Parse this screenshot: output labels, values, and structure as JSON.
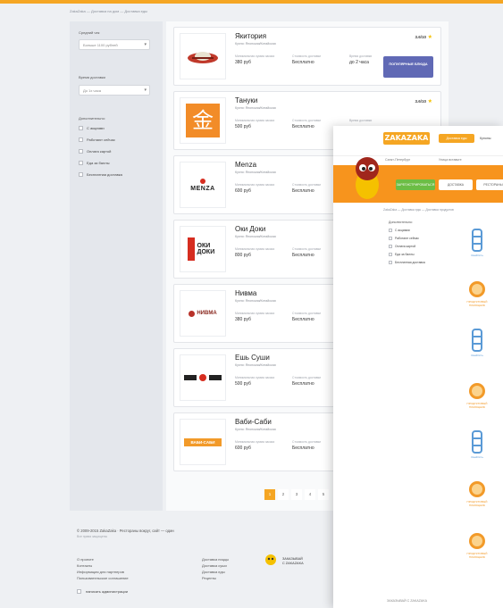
{
  "breadcrumb": "ZakaZaka — Доставка на дом — Доставка еды",
  "sidebar": {
    "avg_check_label": "Средний чек",
    "avg_check_value": "Больше 1100 рублей",
    "delivery_time_label": "Время доставки",
    "delivery_time_value": "До 1х часа",
    "extra_label": "Дополнительно:",
    "options": [
      "С акциями",
      "Работают сейчас",
      "Оплата картой",
      "Еда за баллы",
      "Бесплатная доставка"
    ]
  },
  "labels": {
    "min_order": "Минимальная сумма заказа",
    "delivery_cost": "Стоимость доставки",
    "delivery_time": "Время доставки",
    "menu_button": "ПОПУЛЯРНЫЕ БЛЮДА",
    "cuisine": "Кухня: Японская/Китайская"
  },
  "restaurants": [
    {
      "name": "Якитория",
      "min": "380 руб",
      "cost": "Бесплатно",
      "time": "до 2 часа",
      "rating": "3.6/10",
      "logo": "yakitoriya-logo",
      "logo_text": ""
    },
    {
      "name": "Тануки",
      "min": "500 руб",
      "cost": "Бесплатно",
      "time": "",
      "rating": "3.6/10",
      "logo": "tanuki-logo",
      "logo_text": "金"
    },
    {
      "name": "Menza",
      "min": "600 руб",
      "cost": "Бесплатно",
      "time": "",
      "rating": "",
      "logo": "menza-logo",
      "logo_text": "MENZA"
    },
    {
      "name": "Оки Доки",
      "min": "800 руб",
      "cost": "Бесплатно",
      "time": "",
      "rating": "",
      "logo": "oki-doki-logo",
      "logo_text": "ОКИ ДОКИ"
    },
    {
      "name": "Нивма",
      "min": "380 руб",
      "cost": "Бесплатно",
      "time": "",
      "rating": "",
      "logo": "nivma-logo",
      "logo_text": "НИВМА"
    },
    {
      "name": "Ешь Суши",
      "min": "500 руб",
      "cost": "Бесплатно",
      "time": "",
      "rating": "",
      "logo": "esh-sushi-logo",
      "logo_text": ""
    },
    {
      "name": "Ваби-Саби",
      "min": "600 руб",
      "cost": "Бесплатно",
      "time": "",
      "rating": "",
      "logo": "vabi-sabi-logo",
      "logo_text": "ВАБИ-САБИ"
    }
  ],
  "pagination": [
    "1",
    "2",
    "3",
    "4",
    "5"
  ],
  "footer": {
    "copyright": "© 2009-2015 ZakaZaka · Рестораны вокруг, сайт — один",
    "subline": "Все права защищены",
    "links_col1": [
      "О проекте",
      "Контакты",
      "Информация для партнеров",
      "Пользовательское соглашение"
    ],
    "links_col2": [
      "Доставка пиццы",
      "Доставка суши",
      "Доставка еды",
      "Рецепты"
    ],
    "app_line1": "ЗАКАЗЫВАЙ",
    "app_line2": "С ZAKAZAKA",
    "admin_label": "написать администрации"
  },
  "overlay": {
    "logo_text": "ZAKAZAKA",
    "tab_active": "Доставка еды",
    "tab_other": "Купоны",
    "city": "Санкт-Петербург",
    "street": "Улица вставьте",
    "btn_green": "ЗАРЕГИСТРИРОВАТЬСЯ",
    "btn_gray1": "ДОСТАВКА",
    "btn_gray2": "РЕСТОРАНЫ",
    "breadcrumb": "ZakaZaka — Доставка еды — Доставка продуктов",
    "filter_title": "Дополнительно:",
    "filters": [
      "С акциями",
      "Работают сейчас",
      "Оплата картой",
      "Еда за баллы",
      "Бесплатная доставка"
    ],
    "restaurants": [
      {
        "caption": "ОкейОсть",
        "color": "#5a9ad6"
      },
      {
        "caption": "ПРОДУКТОВЫЙ ПОМОЩНИК",
        "color": "#f29a29"
      },
      {
        "caption": "ОкейОсть",
        "color": "#5a9ad6"
      },
      {
        "caption": "ПРОДУКТОВЫЙ ПОМОЩНИК",
        "color": "#f29a29"
      },
      {
        "caption": "ОкейОсть",
        "color": "#5a9ad6"
      },
      {
        "caption": "ПРОДУКТОВЫЙ ПОМОЩНИК",
        "color": "#f29a29"
      },
      {
        "caption": "ПРОДУКТОВЫЙ ПОМОЩНИК",
        "color": "#f29a29"
      }
    ],
    "footer_text": "ЗАКАЗЫВАЙ С ZAKAZAKA"
  },
  "colors": {
    "accent": "#f5a623",
    "button_purple": "#6069b5",
    "banner_orange": "#f7941d",
    "green": "#6cbd45"
  }
}
